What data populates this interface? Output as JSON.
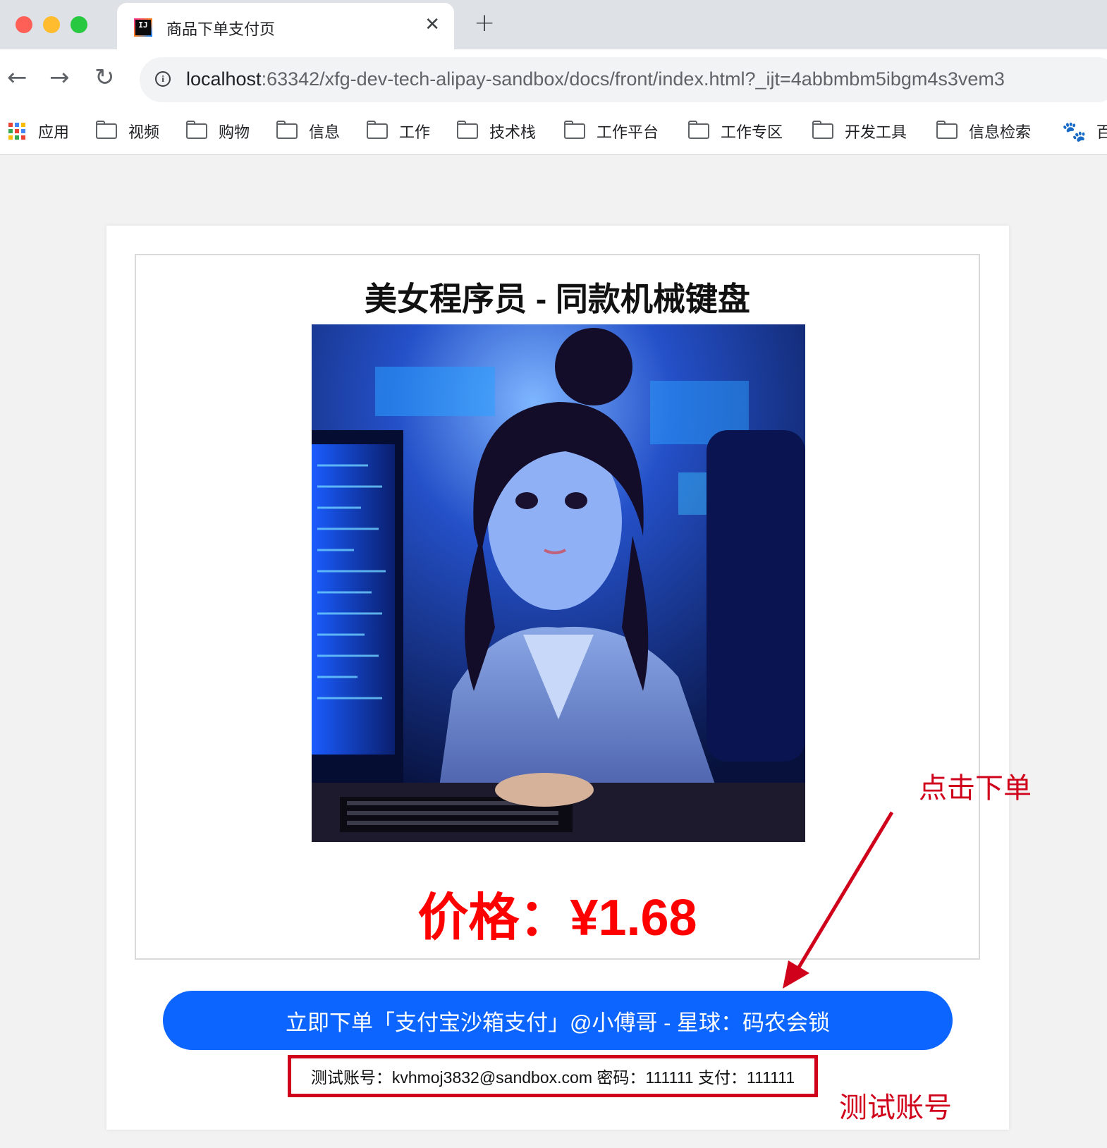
{
  "browser": {
    "tab": {
      "title": "商品下单支付页",
      "favicon_text": "IJ"
    },
    "url": {
      "host": "localhost",
      "rest": ":63342/xfg-dev-tech-alipay-sandbox/docs/front/index.html?_ijt=4abbmbm5ibgm4s3vem3"
    },
    "bookmarks": [
      {
        "label": "应用",
        "icon": "apps-grid-icon"
      },
      {
        "label": "视频",
        "icon": "folder-icon"
      },
      {
        "label": "购物",
        "icon": "folder-icon"
      },
      {
        "label": "信息",
        "icon": "folder-icon"
      },
      {
        "label": "工作",
        "icon": "folder-icon"
      },
      {
        "label": "技术栈",
        "icon": "folder-icon"
      },
      {
        "label": "工作平台",
        "icon": "folder-icon"
      },
      {
        "label": "工作专区",
        "icon": "folder-icon"
      },
      {
        "label": "开发工具",
        "icon": "folder-icon"
      },
      {
        "label": "信息检索",
        "icon": "folder-icon"
      },
      {
        "label": "百",
        "icon": "baidu-paw-icon"
      }
    ]
  },
  "product": {
    "title": "美女程序员 - 同款机械键盘",
    "price": "价格：¥1.68"
  },
  "order_button": {
    "label": "立即下单「支付宝沙箱支付」@小傅哥 - 星球：码农会锁"
  },
  "test_account": {
    "text": "测试账号：kvhmoj3832@sandbox.com 密码：111111 支付：111111"
  },
  "annotations": {
    "click_hint": "点击下单",
    "account_hint": "测试账号"
  },
  "colors": {
    "button": "#0c65ff",
    "price": "#ff0000",
    "annotation": "#d0021b"
  }
}
